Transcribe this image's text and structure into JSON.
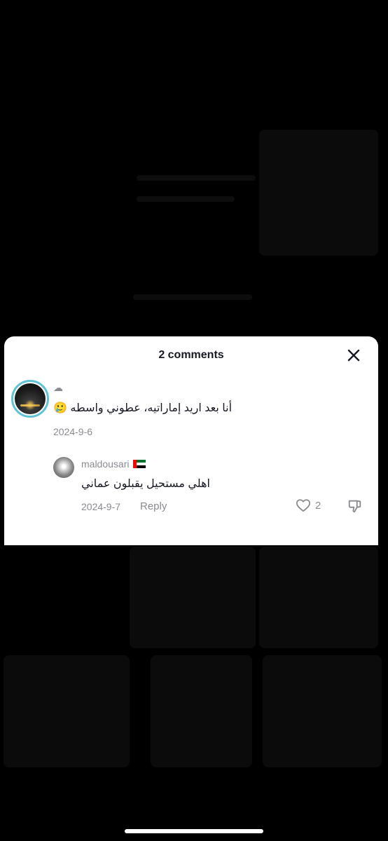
{
  "sheet": {
    "title": "2 comments",
    "close_icon": "close-icon"
  },
  "comments": [
    {
      "username": "☁",
      "text": "أنا بعد اريد إماراتيه، عطوني واسطه 🥲",
      "date": "2024-9-6"
    }
  ],
  "reply": {
    "username": "maldousari",
    "flag": "🇦🇪",
    "text": "اهلي مستحيل يقبلون عماني",
    "date": "2024-9-7",
    "reply_label": "Reply",
    "like_count": "2",
    "like_icon": "heart-outline-icon",
    "dislike_icon": "thumbs-down-icon"
  },
  "colors": {
    "avatar_ring": "#5fc3d6",
    "secondary_text": "#8a8b91",
    "primary_text": "#161823",
    "backdrop": "#000000"
  }
}
